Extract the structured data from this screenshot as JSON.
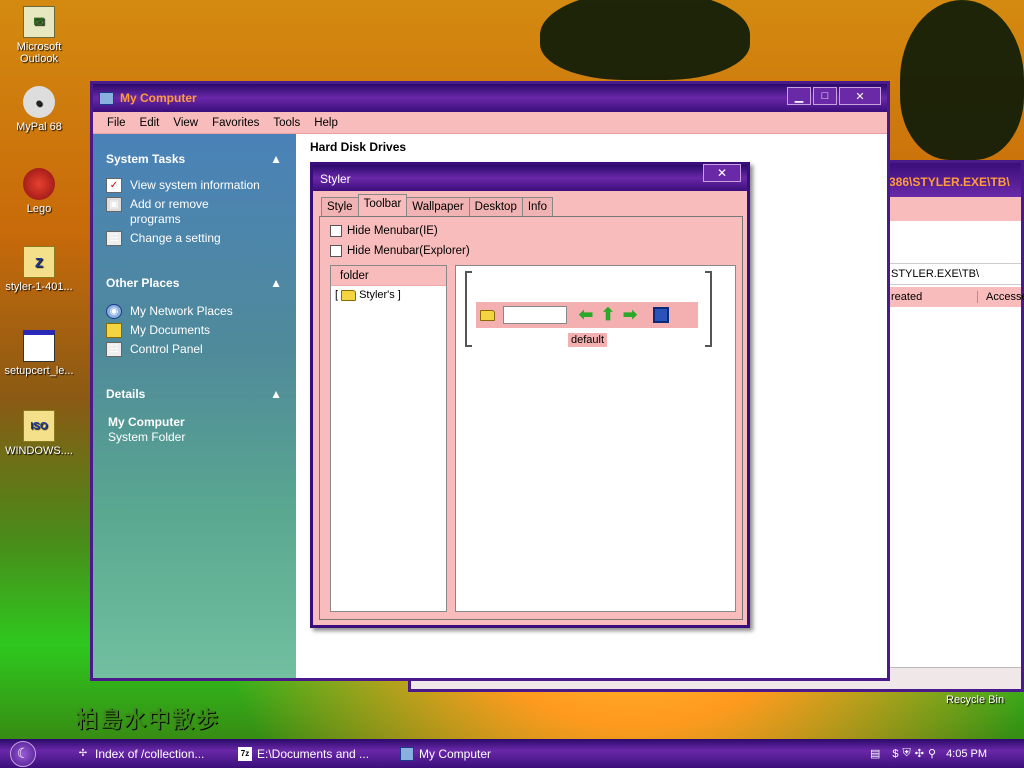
{
  "desktop": {
    "icons": [
      {
        "label": "Microsoft Outlook",
        "icon": "outlook-icon"
      },
      {
        "label": "MyPal 68",
        "icon": "raccoon-icon"
      },
      {
        "label": "Lego",
        "icon": "lego-icon"
      },
      {
        "label": "styler-1-401...",
        "icon": "zip-file-icon"
      },
      {
        "label": "setupcert_le...",
        "icon": "window-file-icon"
      },
      {
        "label": "WINDOWS....",
        "icon": "iso-file-icon"
      }
    ],
    "recycle_bin": "Recycle Bin",
    "watermark": "柏島水中散歩"
  },
  "back_window": {
    "title_fragment": "386\\STYLER.EXE\\TB\\",
    "address_fragment": "STYLER.EXE\\TB\\",
    "col_created": "reated",
    "col_accessed": "Accesse"
  },
  "my_computer": {
    "title": "My Computer",
    "menu": [
      "File",
      "Edit",
      "View",
      "Favorites",
      "Tools",
      "Help"
    ],
    "system_tasks": {
      "heading": "System Tasks",
      "items": [
        "View system information",
        "Add or remove programs",
        "Change a setting"
      ]
    },
    "other_places": {
      "heading": "Other Places",
      "items": [
        "My Network Places",
        "My Documents",
        "Control Panel"
      ]
    },
    "details": {
      "heading": "Details",
      "name": "My Computer",
      "type": "System Folder"
    },
    "content_heading": "Hard Disk Drives"
  },
  "styler": {
    "title": "Styler",
    "close": "✕",
    "tabs": [
      "Style",
      "Toolbar",
      "Wallpaper",
      "Desktop",
      "Info"
    ],
    "active_tab": "Toolbar",
    "options": [
      "Hide Menubar(IE)",
      "Hide Menubar(Explorer)"
    ],
    "tree_header": "folder",
    "tree_node": "Styler's",
    "preview_label": "default"
  },
  "taskbar": {
    "tasks": [
      {
        "label": "Index of /collection...",
        "icon": "ie-icon"
      },
      {
        "label": "E:\\Documents and ...",
        "icon": "7zip-icon"
      },
      {
        "label": "My Computer",
        "icon": "my-computer-icon"
      }
    ],
    "clock": "4:05 PM"
  },
  "colors": {
    "titlebar": "#4a1a8a",
    "title_text": "#ff9b3c",
    "pink_surface": "#f8bcbc"
  }
}
